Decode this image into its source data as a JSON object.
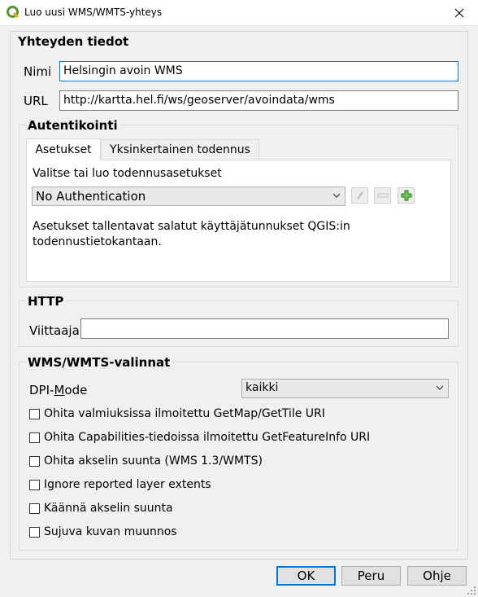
{
  "window": {
    "title": "Luo uusi WMS/WMTS-yhteys"
  },
  "connection": {
    "group_title": "Yhteyden tiedot",
    "name_label": "Nimi",
    "name_value": "Helsingin avoin WMS",
    "url_label": "URL",
    "url_value": "http://kartta.hel.fi/ws/geoserver/avoindata/wms"
  },
  "auth": {
    "group_title": "Autentikointi",
    "tabs": [
      "Asetukset",
      "Yksinkertainen todennus"
    ],
    "select_label": "Valitse tai luo todennusasetukset",
    "method_value": "No Authentication",
    "info_text_line1": "Asetukset tallentavat salatut käyttäjätunnukset QGIS:in",
    "info_text_line2": "todennustietokantaan."
  },
  "http": {
    "group_title": "HTTP",
    "referer_label": "Viittaaja",
    "referer_value": ""
  },
  "wms": {
    "group_title": "WMS/WMTS-valinnat",
    "dpi_label_pre": "DPI-",
    "dpi_label_mnemonic": "M",
    "dpi_label_post": "ode",
    "dpi_value": "kaikki",
    "options": [
      "Ohita valmiuksissa ilmoitettu GetMap/GetTile URI",
      "Ohita Capabilities-tiedoissa ilmoitettu GetFeatureInfo URI",
      "Ohita akselin suunta (WMS 1.3/WMTS)",
      "Ignore reported layer extents",
      "Käännä akselin suunta",
      "Sujuva kuvan muunnos"
    ]
  },
  "buttons": {
    "ok": "OK",
    "cancel": "Peru",
    "help": "Ohje"
  },
  "colors": {
    "focus_border": "#0078d7",
    "qgis_green": "#589632",
    "qgis_yellow": "#eeb111"
  }
}
